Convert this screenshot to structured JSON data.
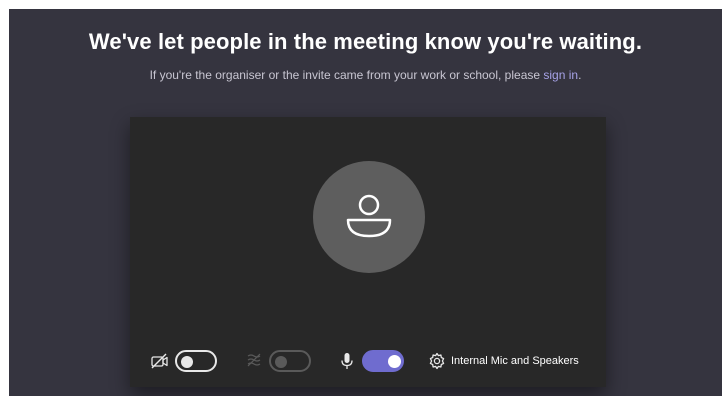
{
  "header": {
    "title": "We've let people in the meeting know you're waiting.",
    "subtitle_prefix": "If you're the organiser or the invite came from your work or school, please ",
    "signin_link": "sign in",
    "subtitle_suffix": "."
  },
  "preview": {
    "avatar_icon": "person-icon"
  },
  "controls": {
    "camera": {
      "icon": "camera-off-icon",
      "state": "off"
    },
    "background_blur": {
      "icon": "background-blur-icon",
      "state": "disabled"
    },
    "microphone": {
      "icon": "microphone-icon",
      "state": "on"
    },
    "device_settings": {
      "icon": "gear-icon",
      "label": "Internal Mic and Speakers"
    }
  },
  "colors": {
    "page_background": "#35343f",
    "preview_background": "#282828",
    "avatar_background": "#5e5e5e",
    "accent": "#6f6ccf",
    "link": "#a7a3e8"
  }
}
